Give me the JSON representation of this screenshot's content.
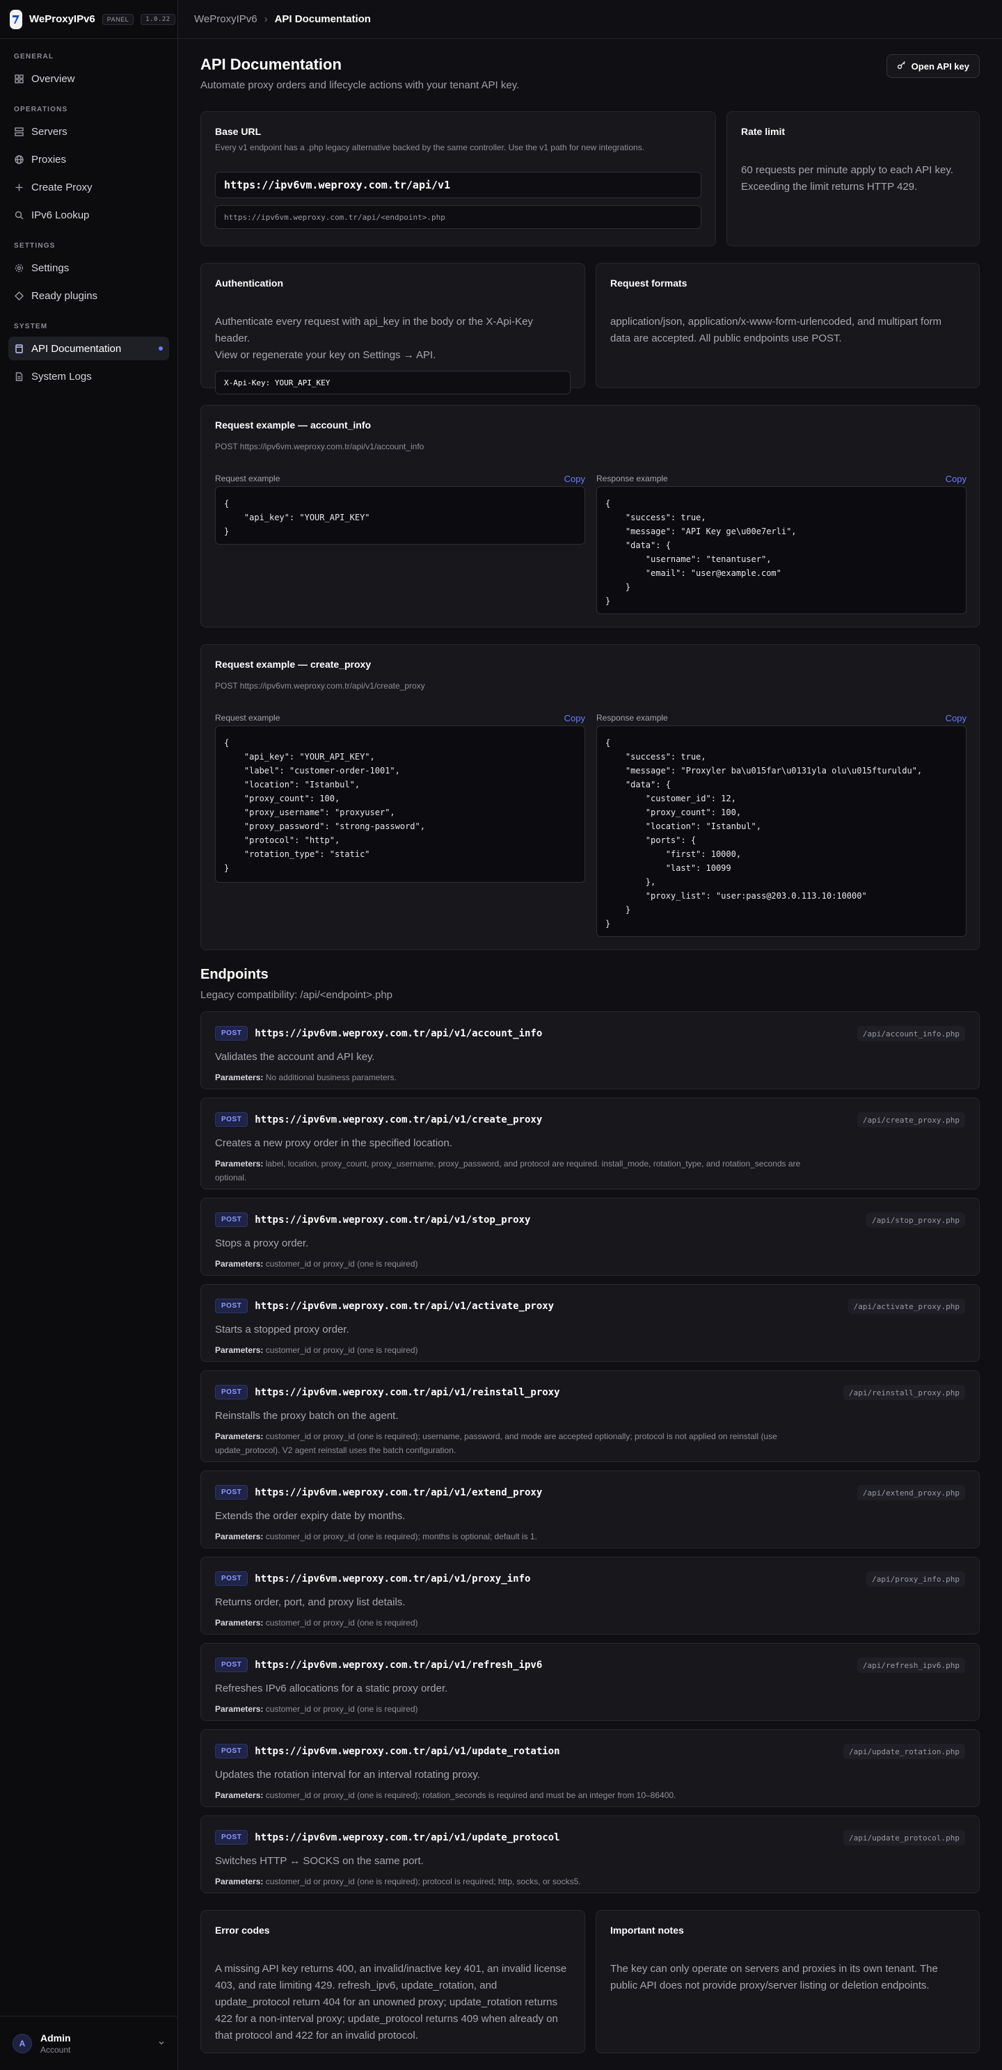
{
  "brand": {
    "name": "WeProxyIPv6",
    "panel_badge": "PANEL",
    "version": "1.0.22"
  },
  "sidebar": {
    "sections": [
      {
        "heading": "GENERAL",
        "items": [
          {
            "label": "Overview",
            "icon": "grid-icon"
          }
        ]
      },
      {
        "heading": "OPERATIONS",
        "items": [
          {
            "label": "Servers",
            "icon": "server-icon"
          },
          {
            "label": "Proxies",
            "icon": "globe-icon"
          },
          {
            "label": "Create Proxy",
            "icon": "plus-icon"
          },
          {
            "label": "IPv6 Lookup",
            "icon": "search-icon"
          }
        ]
      },
      {
        "heading": "SETTINGS",
        "items": [
          {
            "label": "Settings",
            "icon": "gear-icon"
          },
          {
            "label": "Ready plugins",
            "icon": "plugin-icon"
          }
        ]
      },
      {
        "heading": "SYSTEM",
        "items": [
          {
            "label": "API Documentation",
            "icon": "book-icon",
            "active": true
          },
          {
            "label": "System Logs",
            "icon": "file-icon"
          }
        ]
      }
    ],
    "user": {
      "initial": "A",
      "name": "Admin",
      "role": "Account"
    }
  },
  "topbar": {
    "crumb_parent": "WeProxyIPv6",
    "separator": "›",
    "crumb_current": "API Documentation"
  },
  "page": {
    "title": "API Documentation",
    "subtitle": "Automate proxy orders and lifecycle actions with your tenant API key.",
    "open_key_button": "Open API key"
  },
  "base_url": {
    "title": "Base URL",
    "subtitle": "Every v1 endpoint has a .php legacy alternative backed by the same controller. Use the v1 path for new integrations.",
    "primary": "https://ipv6vm.weproxy.com.tr/api/v1",
    "legacy": "https://ipv6vm.weproxy.com.tr/api/<endpoint>.php"
  },
  "rate_limit": {
    "title": "Rate limit",
    "text_1": "60 requests per minute apply to each API key.",
    "text_2": "Exceeding the limit returns HTTP 429."
  },
  "authentication": {
    "title": "Authentication",
    "text_1": "Authenticate every request with api_key in the body or the X-Api-Key header.",
    "text_2": "View or regenerate your key on Settings → API.",
    "header_example": "X-Api-Key: YOUR_API_KEY"
  },
  "request_formats": {
    "title": "Request formats",
    "text_1": "application/json, application/x-www-form-urlencoded, and multipart form",
    "text_2": "data are accepted. All public endpoints use POST."
  },
  "examples": [
    {
      "title": "Request example — account_info",
      "endpoint": "POST https://ipv6vm.weproxy.com.tr/api/v1/account_info",
      "request_label": "Request example",
      "response_label": "Response example",
      "copy": "Copy",
      "request_code": "{\n    \"api_key\": \"YOUR_API_KEY\"\n}",
      "response_code": "{\n    \"success\": true,\n    \"message\": \"API Key ge\\u00e7erli\",\n    \"data\": {\n        \"username\": \"tenantuser\",\n        \"email\": \"user@example.com\"\n    }\n}"
    },
    {
      "title": "Request example — create_proxy",
      "endpoint": "POST https://ipv6vm.weproxy.com.tr/api/v1/create_proxy",
      "request_label": "Request example",
      "response_label": "Response example",
      "copy": "Copy",
      "request_code": "{\n    \"api_key\": \"YOUR_API_KEY\",\n    \"label\": \"customer-order-1001\",\n    \"location\": \"Istanbul\",\n    \"proxy_count\": 100,\n    \"proxy_username\": \"proxyuser\",\n    \"proxy_password\": \"strong-password\",\n    \"protocol\": \"http\",\n    \"rotation_type\": \"static\"\n}",
      "response_code": "{\n    \"success\": true,\n    \"message\": \"Proxyler ba\\u015far\\u0131yla olu\\u015fturuldu\",\n    \"data\": {\n        \"customer_id\": 12,\n        \"proxy_count\": 100,\n        \"location\": \"Istanbul\",\n        \"ports\": {\n            \"first\": 10000,\n            \"last\": 10099\n        },\n        \"proxy_list\": \"user:pass@203.0.113.10:10000\"\n    }\n}"
    }
  ],
  "endpoints_section": {
    "title": "Endpoints",
    "subtitle": "Legacy compatibility: /api/<endpoint>.php",
    "method": "POST",
    "params_label": "Parameters:"
  },
  "endpoints": [
    {
      "url": "https://ipv6vm.weproxy.com.tr/api/v1/account_info",
      "legacy": "/api/account_info.php",
      "desc": "Validates the account and API key.",
      "params": "No additional business parameters."
    },
    {
      "url": "https://ipv6vm.weproxy.com.tr/api/v1/create_proxy",
      "legacy": "/api/create_proxy.php",
      "desc": "Creates a new proxy order in the specified location.",
      "params": "label, location, proxy_count, proxy_username, proxy_password, and protocol are required. install_mode, rotation_type, and rotation_seconds are optional."
    },
    {
      "url": "https://ipv6vm.weproxy.com.tr/api/v1/stop_proxy",
      "legacy": "/api/stop_proxy.php",
      "desc": "Stops a proxy order.",
      "params": "customer_id or proxy_id (one is required)"
    },
    {
      "url": "https://ipv6vm.weproxy.com.tr/api/v1/activate_proxy",
      "legacy": "/api/activate_proxy.php",
      "desc": "Starts a stopped proxy order.",
      "params": "customer_id or proxy_id (one is required)"
    },
    {
      "url": "https://ipv6vm.weproxy.com.tr/api/v1/reinstall_proxy",
      "legacy": "/api/reinstall_proxy.php",
      "desc": "Reinstalls the proxy batch on the agent.",
      "params": "customer_id or proxy_id (one is required); username, password, and mode are accepted optionally; protocol is not applied on reinstall (use update_protocol). V2 agent reinstall uses the batch configuration."
    },
    {
      "url": "https://ipv6vm.weproxy.com.tr/api/v1/extend_proxy",
      "legacy": "/api/extend_proxy.php",
      "desc": "Extends the order expiry date by months.",
      "params": "customer_id or proxy_id (one is required); months is optional; default is 1."
    },
    {
      "url": "https://ipv6vm.weproxy.com.tr/api/v1/proxy_info",
      "legacy": "/api/proxy_info.php",
      "desc": "Returns order, port, and proxy list details.",
      "params": "customer_id or proxy_id (one is required)"
    },
    {
      "url": "https://ipv6vm.weproxy.com.tr/api/v1/refresh_ipv6",
      "legacy": "/api/refresh_ipv6.php",
      "desc": "Refreshes IPv6 allocations for a static proxy order.",
      "params": "customer_id or proxy_id (one is required)"
    },
    {
      "url": "https://ipv6vm.weproxy.com.tr/api/v1/update_rotation",
      "legacy": "/api/update_rotation.php",
      "desc": "Updates the rotation interval for an interval rotating proxy.",
      "params": "customer_id or proxy_id (one is required); rotation_seconds is required and must be an integer from 10–86400."
    },
    {
      "url": "https://ipv6vm.weproxy.com.tr/api/v1/update_protocol",
      "legacy": "/api/update_protocol.php",
      "desc": "Switches HTTP ↔ SOCKS on the same port.",
      "params": "customer_id or proxy_id (one is required); protocol is required; http, socks, or socks5."
    }
  ],
  "error_codes": {
    "title": "Error codes",
    "text": "A missing API key returns 400, an invalid/inactive key 401, an invalid license 403, and rate limiting 429. refresh_ipv6, update_rotation, and update_protocol return 404 for an unowned proxy; update_rotation returns 422 for a non-interval proxy; update_protocol returns 409 when already on that protocol and 422 for an invalid protocol."
  },
  "important_notes": {
    "title": "Important notes",
    "text": "The key can only operate on servers and proxies in its own tenant. The public API does not provide proxy/server listing or deletion endpoints."
  }
}
